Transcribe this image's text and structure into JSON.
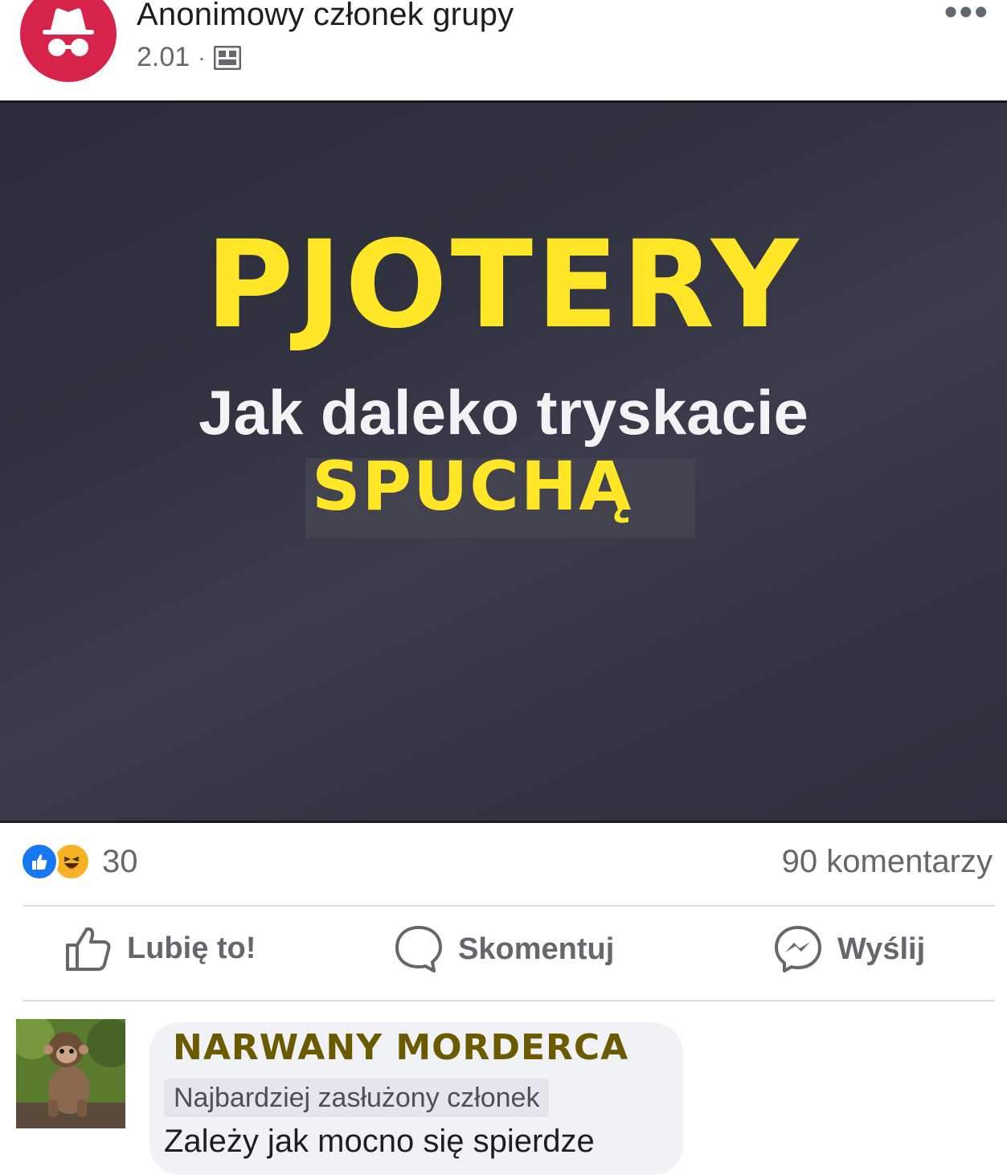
{
  "post": {
    "author": "Anonimowy członek grupy",
    "date": "2.01",
    "separator": "·",
    "more_label": "•••",
    "icons": {
      "avatar": "incognito-icon",
      "audience": "group-icon",
      "more": "more-dots-icon"
    },
    "colors": {
      "avatar_bg": "#d7234a",
      "accent": "#1877f2"
    }
  },
  "image": {
    "title": "PJOTERY",
    "subtitle": "Jak daleko tryskacie",
    "overlay_word": "SPUCHĄ",
    "colors": {
      "title": "#ffe727",
      "subtitle": "#f3f3f6"
    }
  },
  "stats": {
    "reaction_count": "30",
    "comments_count": "90 komentarzy",
    "reaction_icons": [
      "like-reaction-icon",
      "haha-reaction-icon"
    ]
  },
  "actions": [
    {
      "label": "Lubię to!",
      "icon": "thumbs-up-icon"
    },
    {
      "label": "Skomentuj",
      "icon": "comment-bubble-icon"
    },
    {
      "label": "Wyślij",
      "icon": "messenger-icon"
    }
  ],
  "comment": {
    "name": "NARWANY MORDERCA",
    "badge": "Najbardziej zasłużony członek",
    "text": "Zależy jak mocno się spierdze"
  }
}
